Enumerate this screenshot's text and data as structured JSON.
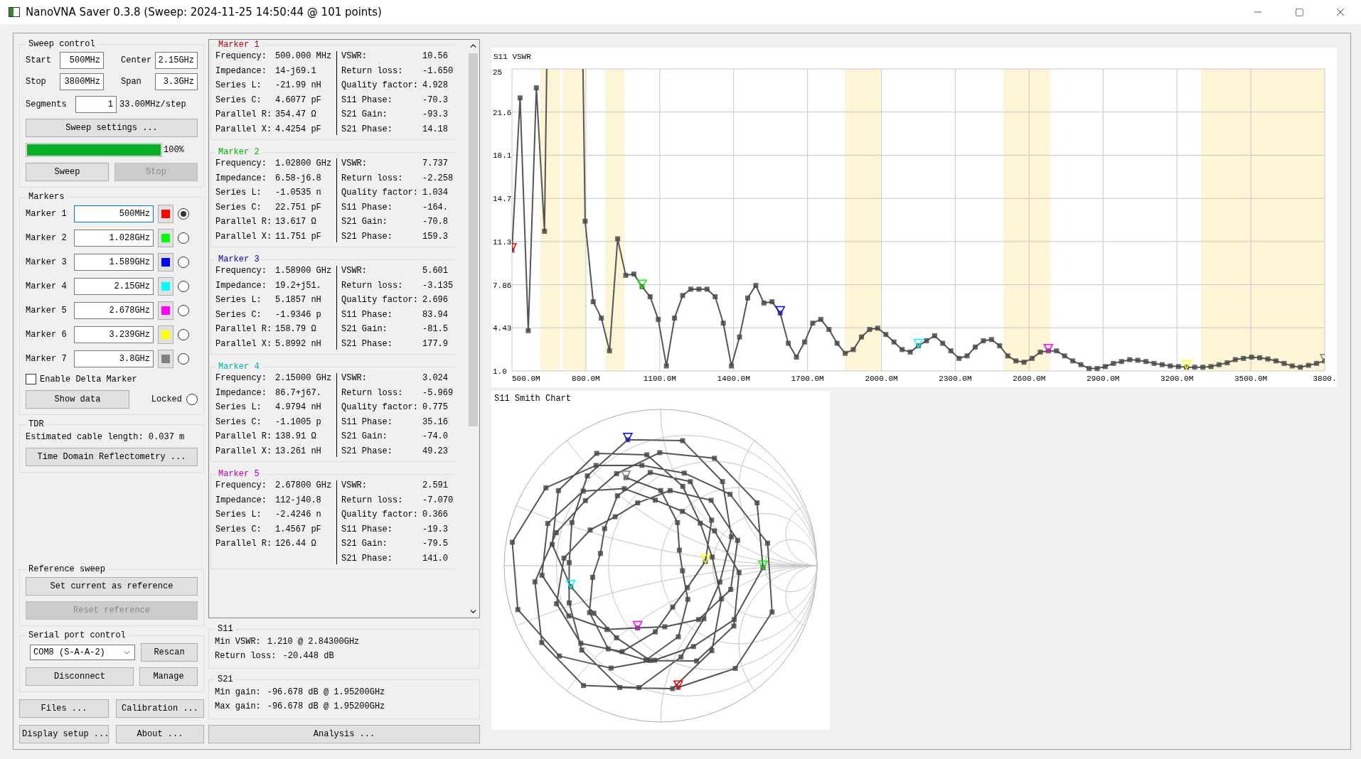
{
  "window": {
    "title": "NanoVNA Saver 0.3.8 (Sweep: 2024-11-25 14:50:44 @ 101 points)"
  },
  "sweep_control": {
    "title": "Sweep control",
    "fields": [
      {
        "label": "Start",
        "value": "500MHz"
      },
      {
        "label": "Center",
        "value": "2.15GHz"
      },
      {
        "label": "Stop",
        "value": "3800MHz"
      },
      {
        "label": "Span",
        "value": "3.3GHz"
      }
    ],
    "segments": {
      "label": "Segments",
      "value": "1"
    },
    "step": "33.00MHz/step",
    "settings_button": "Sweep settings ...",
    "progress": {
      "level": 1.0,
      "reading": "100%"
    },
    "buttons": [
      {
        "label": "Sweep",
        "disabled": false
      },
      {
        "label": "Stop",
        "disabled": true
      }
    ]
  },
  "markers": {
    "title": "Markers",
    "items": [
      {
        "label": "Marker 1",
        "value": "500MHz",
        "color": "#ff0000",
        "selected": true,
        "focused": true
      },
      {
        "label": "Marker 2",
        "value": "1.028GHz",
        "color": "#00ff00",
        "selected": false,
        "focused": false
      },
      {
        "label": "Marker 3",
        "value": "1.589GHz",
        "color": "#0000ff",
        "selected": false,
        "focused": false
      },
      {
        "label": "Marker 4",
        "value": "2.15GHz",
        "color": "#00ffff",
        "selected": false,
        "focused": false
      },
      {
        "label": "Marker 5",
        "value": "2.678GHz",
        "color": "#ff00ff",
        "selected": false,
        "focused": false
      },
      {
        "label": "Marker 6",
        "value": "3.239GHz",
        "color": "#ffff00",
        "selected": false,
        "focused": false
      },
      {
        "label": "Marker 7",
        "value": "3.8GHz",
        "color": "#808080",
        "selected": false,
        "focused": false
      }
    ],
    "delta": {
      "label": "Enable Delta Marker",
      "checked": false
    },
    "show_data": "Show data",
    "locked": {
      "label": "Locked",
      "checked": false
    }
  },
  "tdr": {
    "title": "TDR",
    "cable_length": "Estimated cable length: 0.037 m",
    "button": "Time Domain Reflectometry ..."
  },
  "reference_sweep": {
    "title": "Reference sweep",
    "buttons": [
      {
        "label": "Set current as reference",
        "disabled": false
      },
      {
        "label": "Reset reference",
        "disabled": true
      }
    ]
  },
  "serial_port": {
    "title": "Serial port control",
    "port": "COM8 (S-A-A-2)",
    "buttons": [
      "Rescan",
      "Disconnect",
      "Manage"
    ]
  },
  "bottom_buttons": [
    "Files ...",
    "Calibration ...",
    "Display setup ...",
    "About ..."
  ],
  "marker_data": [
    {
      "title": "Marker 1",
      "left": [
        {
          "label": "Frequency:",
          "value": "500.000 MHz"
        },
        {
          "label": "Impedance:",
          "value": "14-j69.1"
        },
        {
          "label": "Series L:",
          "value": "-21.99 nH"
        },
        {
          "label": "Series C:",
          "value": "4.6077 pF"
        },
        {
          "label": "Parallel R:",
          "value": "354.47 Ω"
        },
        {
          "label": "Parallel X:",
          "value": "4.4254 pF"
        }
      ],
      "right": [
        {
          "label": "VSWR:",
          "value": "10.56"
        },
        {
          "label": "Return loss:",
          "value": "-1.650"
        },
        {
          "label": "Quality factor:",
          "value": "4.928"
        },
        {
          "label": "S11 Phase:",
          "value": "-70.3"
        },
        {
          "label": "S21 Gain:",
          "value": "-93.3"
        },
        {
          "label": "S21 Phase:",
          "value": "14.18"
        }
      ]
    },
    {
      "title": "Marker 2",
      "left": [
        {
          "label": "Frequency:",
          "value": "1.02800 GHz"
        },
        {
          "label": "Impedance:",
          "value": "6.58-j6.8"
        },
        {
          "label": "Series L:",
          "value": "-1.0535 n"
        },
        {
          "label": "Series C:",
          "value": "22.751 pF"
        },
        {
          "label": "Parallel R:",
          "value": "13.617 Ω"
        },
        {
          "label": "Parallel X:",
          "value": "11.751 pF"
        }
      ],
      "right": [
        {
          "label": "VSWR:",
          "value": "7.737"
        },
        {
          "label": "Return loss:",
          "value": "-2.258"
        },
        {
          "label": "Quality factor:",
          "value": "1.034"
        },
        {
          "label": "S11 Phase:",
          "value": "-164."
        },
        {
          "label": "S21 Gain:",
          "value": "-70.8"
        },
        {
          "label": "S21 Phase:",
          "value": "159.3"
        }
      ]
    },
    {
      "title": "Marker 3",
      "left": [
        {
          "label": "Frequency:",
          "value": "1.58900 GHz"
        },
        {
          "label": "Impedance:",
          "value": "19.2+j51."
        },
        {
          "label": "Series L:",
          "value": "5.1857 nH"
        },
        {
          "label": "Series C:",
          "value": "-1.9346 p"
        },
        {
          "label": "Parallel R:",
          "value": "158.79 Ω"
        },
        {
          "label": "Parallel X:",
          "value": "5.8992 nH"
        }
      ],
      "right": [
        {
          "label": "VSWR:",
          "value": "5.601"
        },
        {
          "label": "Return loss:",
          "value": "-3.135"
        },
        {
          "label": "Quality factor:",
          "value": "2.696"
        },
        {
          "label": "S11 Phase:",
          "value": "83.94"
        },
        {
          "label": "S21 Gain:",
          "value": "-81.5"
        },
        {
          "label": "S21 Phase:",
          "value": "177.9"
        }
      ]
    },
    {
      "title": "Marker 4",
      "left": [
        {
          "label": "Frequency:",
          "value": "2.15000 GHz"
        },
        {
          "label": "Impedance:",
          "value": "86.7+j67."
        },
        {
          "label": "Series L:",
          "value": "4.9794 nH"
        },
        {
          "label": "Series C:",
          "value": "-1.1005 p"
        },
        {
          "label": "Parallel R:",
          "value": "138.91 Ω"
        },
        {
          "label": "Parallel X:",
          "value": "13.261 nH"
        }
      ],
      "right": [
        {
          "label": "VSWR:",
          "value": "3.024"
        },
        {
          "label": "Return loss:",
          "value": "-5.969"
        },
        {
          "label": "Quality factor:",
          "value": "0.775"
        },
        {
          "label": "S11 Phase:",
          "value": "35.16"
        },
        {
          "label": "S21 Gain:",
          "value": "-74.0"
        },
        {
          "label": "S21 Phase:",
          "value": "49.23"
        }
      ]
    },
    {
      "title": "Marker 5",
      "left": [
        {
          "label": "Frequency:",
          "value": "2.67800 GHz"
        },
        {
          "label": "Impedance:",
          "value": "112-j40.8"
        },
        {
          "label": "Series L:",
          "value": "-2.4246 n"
        },
        {
          "label": "Series C:",
          "value": "1.4567 pF"
        },
        {
          "label": "Parallel R:",
          "value": "126.44 Ω"
        }
      ],
      "right": [
        {
          "label": "VSWR:",
          "value": "2.591"
        },
        {
          "label": "Return loss:",
          "value": "-7.070"
        },
        {
          "label": "Quality factor:",
          "value": "0.366"
        },
        {
          "label": "S11 Phase:",
          "value": "-19.3"
        },
        {
          "label": "S21 Gain:",
          "value": "-79.5"
        },
        {
          "label": "S21 Phase:",
          "value": "141.0"
        }
      ]
    }
  ],
  "s11": {
    "title": "S11",
    "lines": [
      {
        "label": "Min VSWR:",
        "value": "1.210 @ 2.84300GHz"
      },
      {
        "label": "Return loss:",
        "value": "-20.448 dB"
      }
    ]
  },
  "s21": {
    "title": "S21",
    "lines": [
      {
        "label": "Min gain:",
        "value": "-96.678 dB @ 1.95200GHz"
      },
      {
        "label": "Max gain:",
        "value": "-96.678 dB @ 1.95200GHz"
      }
    ]
  },
  "analysis_button": "Analysis ...",
  "vswr_chart": {
    "chart_data": {
      "type": "line",
      "title": "S11 VSWR",
      "xlim": [
        500,
        3800
      ],
      "ylim": [
        1,
        25
      ],
      "xticks": [
        {
          "value": 500,
          "label": "500.0M"
        },
        {
          "value": 800,
          "label": "800.0M"
        },
        {
          "value": 1100,
          "label": "1100.0M"
        },
        {
          "value": 1400,
          "label": "1400.0M"
        },
        {
          "value": 1700,
          "label": "1700.0M"
        },
        {
          "value": 2000,
          "label": "2000.0M"
        },
        {
          "value": 2300,
          "label": "2300.0M"
        },
        {
          "value": 2600,
          "label": "2600.0M"
        },
        {
          "value": 2900,
          "label": "2900.0M"
        },
        {
          "value": 3200,
          "label": "3200.0M"
        },
        {
          "value": 3500,
          "label": "3500.0M"
        },
        {
          "value": 3800,
          "label": "3800."
        }
      ],
      "yticks": [
        {
          "value": 1,
          "label": "1.0"
        },
        {
          "value": 4.4286,
          "label": "4.43"
        },
        {
          "value": 7.857,
          "label": "7.86"
        },
        {
          "value": 11.286,
          "label": "11.3"
        },
        {
          "value": 14.714,
          "label": "14.7"
        },
        {
          "value": 18.143,
          "label": "18.1"
        },
        {
          "value": 21.571,
          "label": "21.6"
        },
        {
          "value": 25,
          "label": "25"
        }
      ],
      "x": [
        500,
        533,
        566,
        599,
        632,
        665,
        698,
        731,
        764,
        797,
        830,
        863,
        896,
        929,
        962,
        995,
        1028,
        1061,
        1094,
        1127,
        1160,
        1193,
        1226,
        1259,
        1292,
        1325,
        1358,
        1391,
        1424,
        1457,
        1490,
        1523,
        1556,
        1589,
        1622,
        1655,
        1688,
        1721,
        1754,
        1787,
        1820,
        1853,
        1886,
        1919,
        1952,
        1985,
        2018,
        2051,
        2084,
        2117,
        2150,
        2183,
        2216,
        2249,
        2282,
        2315,
        2348,
        2381,
        2414,
        2447,
        2480,
        2513,
        2546,
        2579,
        2612,
        2645,
        2678,
        2711,
        2744,
        2777,
        2810,
        2843,
        2876,
        2909,
        2942,
        2975,
        3008,
        3041,
        3074,
        3107,
        3140,
        3173,
        3206,
        3239,
        3272,
        3305,
        3338,
        3371,
        3404,
        3437,
        3470,
        3503,
        3536,
        3569,
        3602,
        3635,
        3668,
        3701,
        3734,
        3767,
        3800
      ],
      "series": [
        {
          "color": "#555555",
          "marker": "square",
          "values": [
            10.6,
            22.7,
            4.2,
            23.5,
            12.1,
            null,
            null,
            null,
            null,
            12.9,
            6.5,
            5.2,
            2.6,
            11.5,
            8.6,
            8.7,
            7.7,
            6.9,
            5.1,
            1.4,
            5.2,
            7.0,
            7.5,
            7.5,
            7.5,
            6.9,
            4.8,
            1.4,
            3.7,
            6.8,
            7.8,
            6.4,
            6.5,
            5.6,
            3.2,
            2.1,
            3.3,
            4.8,
            5.1,
            4.3,
            3.2,
            2.4,
            2.7,
            3.7,
            4.3,
            4.4,
            3.9,
            3.3,
            2.7,
            2.5,
            3.0,
            3.4,
            3.8,
            3.2,
            2.6,
            2.0,
            2.2,
            2.9,
            3.4,
            3.5,
            3.0,
            2.2,
            1.8,
            1.7,
            2.0,
            2.5,
            2.6,
            2.6,
            2.2,
            1.8,
            1.5,
            1.2,
            1.2,
            1.35,
            1.6,
            1.75,
            1.9,
            1.85,
            1.75,
            1.6,
            1.5,
            1.4,
            1.35,
            1.3,
            1.3,
            1.3,
            1.35,
            1.5,
            1.65,
            1.9,
            2.0,
            2.1,
            2.05,
            1.95,
            1.8,
            1.6,
            1.4,
            1.3,
            1.45,
            1.6,
            1.8
          ]
        }
      ],
      "grid": true
    }
  },
  "smith_chart": {
    "title": "S11 Smith Chart"
  }
}
